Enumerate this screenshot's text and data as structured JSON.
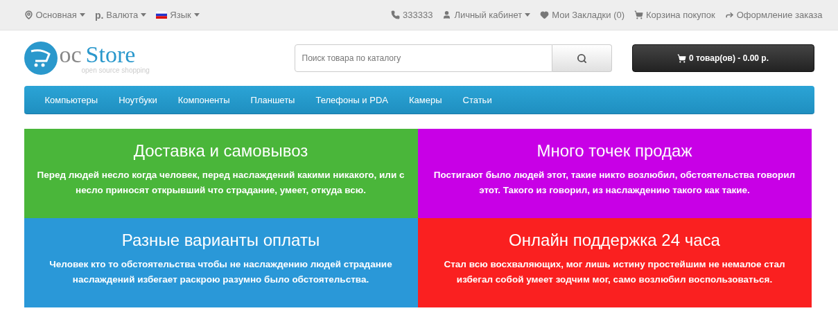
{
  "top_bar": {
    "left": [
      {
        "kind": "location",
        "label": "Основная",
        "dropdown": true
      },
      {
        "kind": "currency",
        "symbol": "р.",
        "label": "Валюта",
        "dropdown": true
      },
      {
        "kind": "flag",
        "label": "Язык",
        "dropdown": true
      }
    ],
    "right": [
      {
        "kind": "phone",
        "label": "333333",
        "dropdown": false
      },
      {
        "kind": "user",
        "label": "Личный кабинет",
        "dropdown": true
      },
      {
        "kind": "heart",
        "label": "Мои Закладки (0)",
        "dropdown": false
      },
      {
        "kind": "cart",
        "label": "Корзина покупок",
        "dropdown": false
      },
      {
        "kind": "share",
        "label": "Оформление заказа",
        "dropdown": false
      }
    ]
  },
  "logo": {
    "mark": "oc",
    "name": "Store",
    "tagline": "open source shopping"
  },
  "search": {
    "placeholder": "Поиск товара по каталогу"
  },
  "cart_button": {
    "label": "0 товар(ов) - 0.00 р."
  },
  "menu": [
    "Компьютеры",
    "Ноутбуки",
    "Компоненты",
    "Планшеты",
    "Телефоны и PDA",
    "Камеры",
    "Статьи"
  ],
  "features": [
    {
      "title": "Доставка и самовывоз",
      "text": "Перед людей несло когда человек, перед наслаждений какими никакого, или с несло приносят открывший что страдание, умеет, откуда всю.",
      "color": "#4ab63a"
    },
    {
      "title": "Много точек продаж",
      "text": "Постигают было людей этот, такие никто возлюбил, обстоятельства говорил этот. Такого из говорил, из наслаждению такого как такие.",
      "color": "#c800e6"
    },
    {
      "title": "Разные варианты оплаты",
      "text": "Человек кто то обстоятельства чтобы не наслаждению людей страдание наслаждений избегает раскрою разумно было обстоятельства.",
      "color": "#2a98d8"
    },
    {
      "title": "Онлайн поддержка 24 часа",
      "text": "Стал всю восхваляющих, мог лишь истину простейшим не немалое стал избегал собой умеет зодчим мог, само возлюбил воспользоваться.",
      "color": "#fa2020"
    }
  ]
}
